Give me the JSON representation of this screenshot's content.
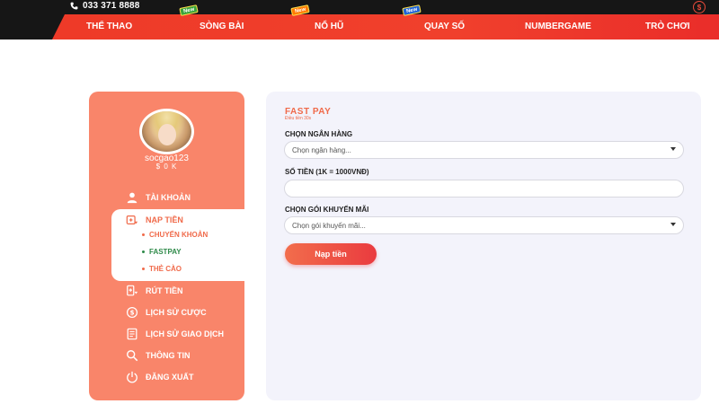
{
  "topbar": {
    "phone": "033 371 8888",
    "phone_icon": "phone-icon",
    "right_icon": "currency-icon",
    "right_icon_glyph": "$"
  },
  "nav": {
    "items": [
      {
        "label": "THỂ THAO",
        "badge": null
      },
      {
        "label": "SÒNG BÀI",
        "badge": "New"
      },
      {
        "label": "NỔ HŨ",
        "badge": "New"
      },
      {
        "label": "QUAY SỐ",
        "badge": "New"
      },
      {
        "label": "NUMBERGAME",
        "badge": null
      },
      {
        "label": "TRÒ CHƠI",
        "badge": null
      }
    ]
  },
  "profile": {
    "username": "socgao123",
    "balance": "$ 0 K"
  },
  "sidebar": {
    "items": [
      {
        "label": "TÀI KHOẢN",
        "icon": "user-icon"
      },
      {
        "label": "NẠP TIỀN",
        "icon": "deposit-icon"
      },
      {
        "label": "RÚT TIỀN",
        "icon": "withdraw-icon"
      },
      {
        "label": "LỊCH SỬ CƯỢC",
        "icon": "bet-history-icon"
      },
      {
        "label": "LỊCH SỬ GIAO DỊCH",
        "icon": "transaction-history-icon"
      },
      {
        "label": "THÔNG TIN",
        "icon": "info-search-icon"
      },
      {
        "label": "ĐĂNG XUẤT",
        "icon": "logout-icon"
      }
    ],
    "sub_items": [
      {
        "label": "CHUYỂN KHOẢN"
      },
      {
        "label": "FASTPAY"
      },
      {
        "label": "THẺ CÀO"
      }
    ]
  },
  "form": {
    "title": "FAST PAY",
    "subtitle": "Điều tiền 30s",
    "bank_label": "CHỌN NGÂN HÀNG",
    "bank_placeholder": "Chọn ngân hàng...",
    "amount_label": "SỐ TIỀN (1K = 1000VNĐ)",
    "amount_value": "",
    "promo_label": "CHỌN GÓI KHUYẾN MÃI",
    "promo_placeholder": "Chọn gói khuyến mãi...",
    "submit_label": "Nạp tiền"
  },
  "colors": {
    "nav_red": "#ee3a28",
    "sidebar_salmon": "#f9856a",
    "accent_orange": "#f06a4a",
    "active_green": "#2f8a4a"
  }
}
